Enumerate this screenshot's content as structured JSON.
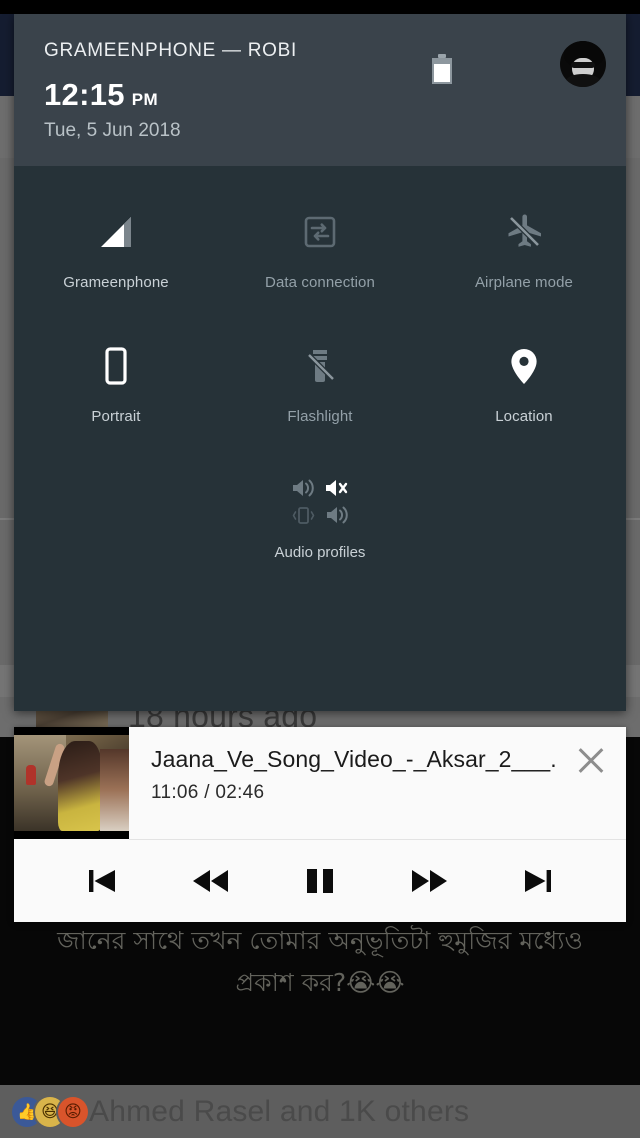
{
  "background": {
    "post_time": "18 hours ago",
    "bengali_line1": "জানের সাথে তখন তোমার অনুভূতিটা হুমুজির মধ্যেও",
    "bengali_line2": "প্রকাশ কর?😭😭",
    "footer_reactions_text": "Ahmed Rasel and 1K others",
    "reactions": [
      {
        "name": "like-reaction-icon",
        "glyph": "👍",
        "color": "#3b5998"
      },
      {
        "name": "haha-reaction-icon",
        "glyph": "😆",
        "color": "#d9b44a"
      },
      {
        "name": "angry-reaction-icon",
        "glyph": "😠",
        "color": "#d9542b"
      }
    ]
  },
  "quick_settings": {
    "header": {
      "carrier": "GRAMEENPHONE — ROBI",
      "time": "12:15",
      "ampm": "PM",
      "date": "Tue, 5 Jun 2018",
      "battery_icon": "battery-icon",
      "avatar": "user-avatar"
    },
    "tiles": [
      {
        "label": "Grameenphone",
        "icon": "signal-bars-icon",
        "state": "on"
      },
      {
        "label": "Data connection",
        "icon": "data-sync-icon",
        "state": "off"
      },
      {
        "label": "Airplane mode",
        "icon": "airplane-off-icon",
        "state": "off"
      },
      {
        "label": "Portrait",
        "icon": "phone-portrait-icon",
        "state": "on"
      },
      {
        "label": "Flashlight",
        "icon": "flashlight-off-icon",
        "state": "off"
      },
      {
        "label": "Location",
        "icon": "location-pin-icon",
        "state": "on"
      }
    ],
    "audio": {
      "label": "Audio profiles",
      "modes": [
        {
          "name": "sound-on-icon",
          "active": false
        },
        {
          "name": "sound-mute-icon",
          "active": true
        },
        {
          "name": "vibrate-icon",
          "active": false
        },
        {
          "name": "sound-loud-icon",
          "active": false
        }
      ]
    }
  },
  "media_player": {
    "title": "Jaana_Ve_Song_Video_-_Aksar_2___..",
    "time": "11:06 / 02:46",
    "close_icon": "close-icon",
    "thumbnail": "video-thumbnail",
    "controls": [
      {
        "name": "previous-track-button",
        "icon": "skip-previous-icon"
      },
      {
        "name": "rewind-button",
        "icon": "fast-rewind-icon"
      },
      {
        "name": "pause-button",
        "icon": "pause-icon"
      },
      {
        "name": "fast-forward-button",
        "icon": "fast-forward-icon"
      },
      {
        "name": "next-track-button",
        "icon": "skip-next-icon"
      }
    ]
  },
  "colors": {
    "panel_header": "#3a434b",
    "panel_body": "#263238",
    "card": "#fafafa",
    "icon_on": "#ffffff",
    "icon_off": "#6c7a82"
  }
}
